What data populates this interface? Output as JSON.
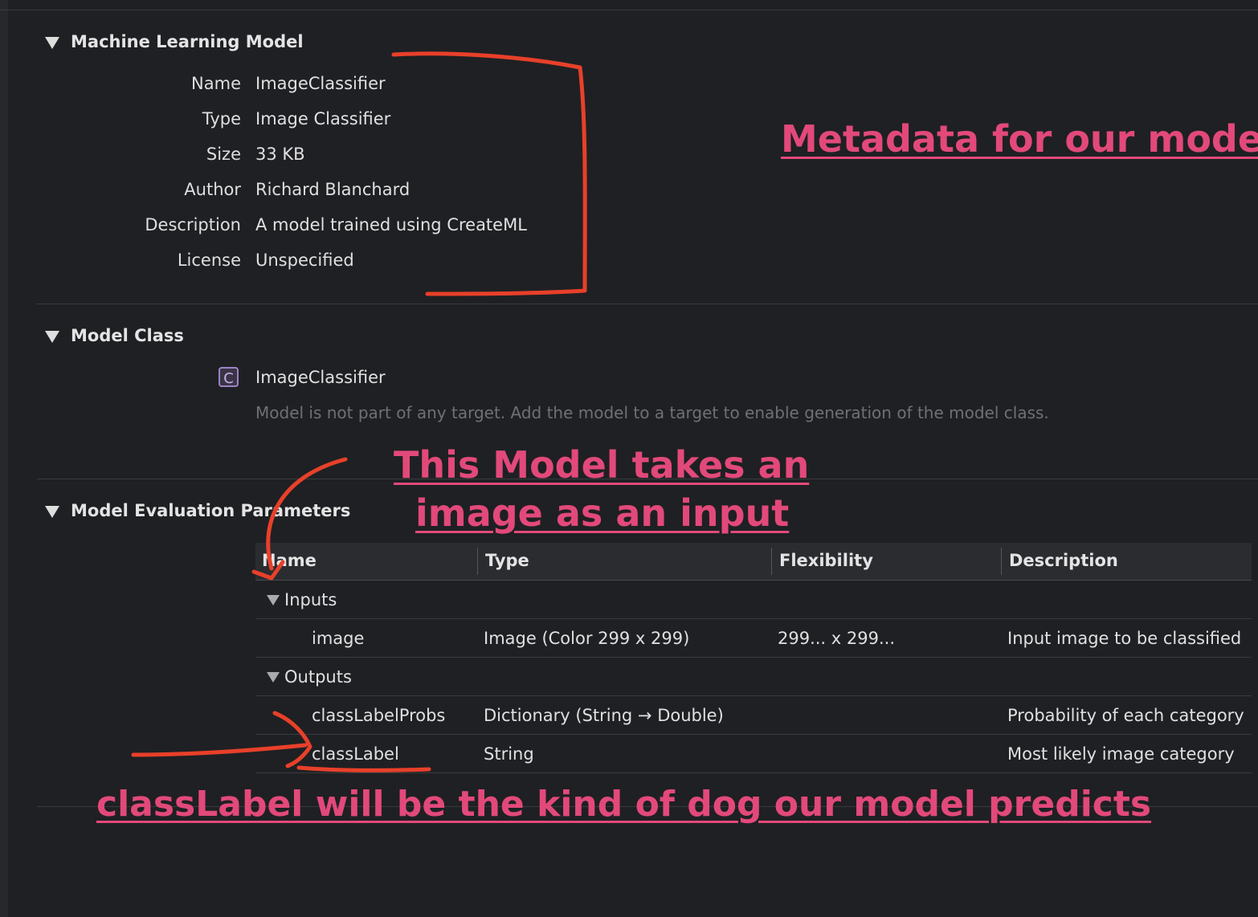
{
  "sections": {
    "ml_model": {
      "title": "Machine Learning Model",
      "fields": [
        {
          "label": "Name",
          "value": "ImageClassifier"
        },
        {
          "label": "Type",
          "value": "Image Classifier"
        },
        {
          "label": "Size",
          "value": "33 KB"
        },
        {
          "label": "Author",
          "value": "Richard Blanchard"
        },
        {
          "label": "Description",
          "value": "A model trained using CreateML"
        },
        {
          "label": "License",
          "value": "Unspecified"
        }
      ]
    },
    "model_class": {
      "title": "Model Class",
      "icon_letter": "C",
      "class_name": "ImageClassifier",
      "note": "Model is not part of any target. Add the model to a target to enable generation of the model class."
    },
    "eval_params": {
      "title": "Model Evaluation Parameters",
      "columns": [
        "Name",
        "Type",
        "Flexibility",
        "Description"
      ],
      "groups": [
        {
          "label": "Inputs",
          "rows": [
            {
              "name": "image",
              "type": "Image (Color 299 x 299)",
              "flexibility": "299... x 299...",
              "description": "Input image to be classified"
            }
          ]
        },
        {
          "label": "Outputs",
          "rows": [
            {
              "name": "classLabelProbs",
              "type": "Dictionary (String → Double)",
              "flexibility": "",
              "description": "Probability of each category"
            },
            {
              "name": "classLabel",
              "type": "String",
              "flexibility": "",
              "description": "Most likely image category"
            }
          ]
        }
      ]
    }
  },
  "annotations": {
    "metadata": "Metadata for our model",
    "input_line1": "This Model takes an",
    "input_line2": "image as an input",
    "classlabel": "classLabel will be the kind of dog our model predicts",
    "color": "#e2497a",
    "stroke_color": "#e8402a"
  }
}
